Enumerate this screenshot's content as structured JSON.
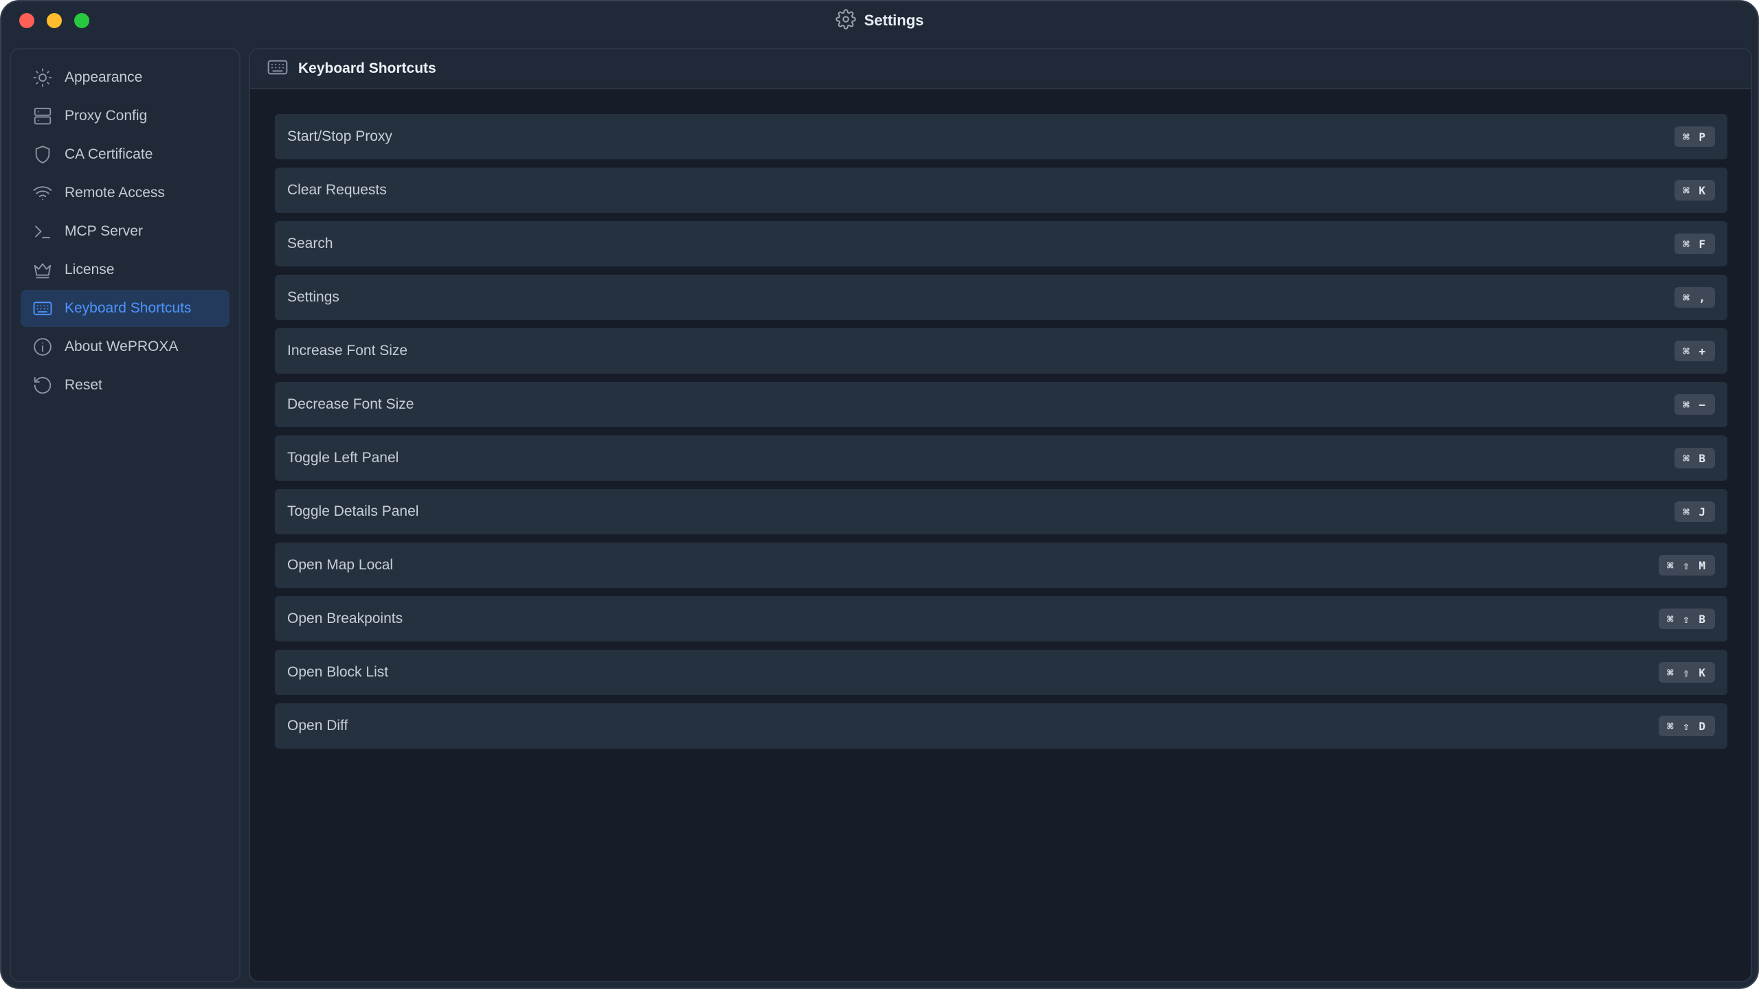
{
  "window": {
    "title": "Settings"
  },
  "sidebar": {
    "items": [
      {
        "label": "Appearance",
        "icon": "sun-icon",
        "active": false
      },
      {
        "label": "Proxy Config",
        "icon": "server-icon",
        "active": false
      },
      {
        "label": "CA Certificate",
        "icon": "shield-icon",
        "active": false
      },
      {
        "label": "Remote Access",
        "icon": "wifi-icon",
        "active": false
      },
      {
        "label": "MCP Server",
        "icon": "terminal-icon",
        "active": false
      },
      {
        "label": "License",
        "icon": "crown-icon",
        "active": false
      },
      {
        "label": "Keyboard Shortcuts",
        "icon": "keyboard-icon",
        "active": true
      },
      {
        "label": "About WePROXA",
        "icon": "info-icon",
        "active": false
      },
      {
        "label": "Reset",
        "icon": "reset-icon",
        "active": false
      }
    ]
  },
  "main": {
    "title": "Keyboard Shortcuts",
    "shortcuts": [
      {
        "label": "Start/Stop Proxy",
        "keys": "⌘ P"
      },
      {
        "label": "Clear Requests",
        "keys": "⌘ K"
      },
      {
        "label": "Search",
        "keys": "⌘ F"
      },
      {
        "label": "Settings",
        "keys": "⌘ ,"
      },
      {
        "label": "Increase Font Size",
        "keys": "⌘ +"
      },
      {
        "label": "Decrease Font Size",
        "keys": "⌘ −"
      },
      {
        "label": "Toggle Left Panel",
        "keys": "⌘ B"
      },
      {
        "label": "Toggle Details Panel",
        "keys": "⌘ J"
      },
      {
        "label": "Open Map Local",
        "keys": "⌘ ⇧ M"
      },
      {
        "label": "Open Breakpoints",
        "keys": "⌘ ⇧ B"
      },
      {
        "label": "Open Block List",
        "keys": "⌘ ⇧ K"
      },
      {
        "label": "Open Diff",
        "keys": "⌘ ⇧ D"
      }
    ]
  },
  "colors": {
    "accent": "#4c95ff",
    "active_bg": "#243a5c",
    "window_bg": "#1f2937",
    "content_bg": "#161d29",
    "row_bg": "#263140"
  }
}
